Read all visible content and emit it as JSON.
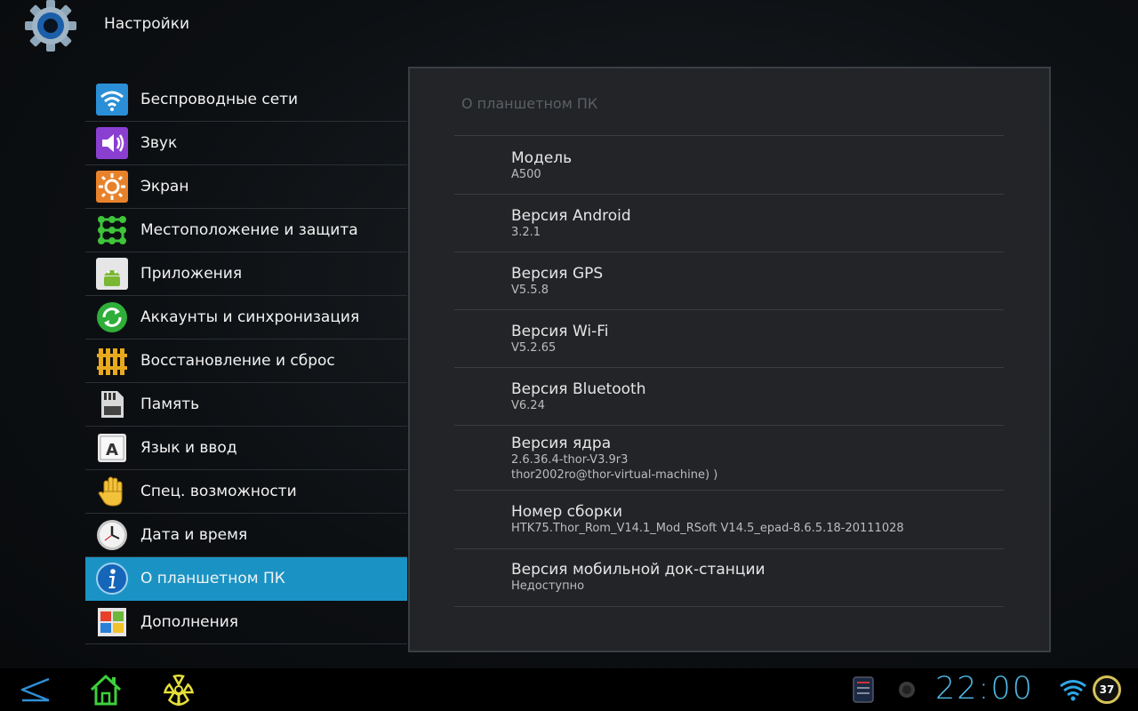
{
  "app": {
    "title": "Настройки",
    "icon": "gear-icon"
  },
  "sidebar": {
    "items": [
      {
        "label": "Беспроводные сети",
        "icon": "wifi-icon"
      },
      {
        "label": "Звук",
        "icon": "speaker-icon"
      },
      {
        "label": "Экран",
        "icon": "brightness-icon"
      },
      {
        "label": "Местоположение и защита",
        "icon": "pattern-lock-icon"
      },
      {
        "label": "Приложения",
        "icon": "android-icon"
      },
      {
        "label": "Аккаунты и синхронизация",
        "icon": "sync-icon"
      },
      {
        "label": "Восстановление и сброс",
        "icon": "fence-icon"
      },
      {
        "label": "Память",
        "icon": "sd-card-icon"
      },
      {
        "label": "Язык и ввод",
        "icon": "keyboard-key-icon"
      },
      {
        "label": "Спец. возможности",
        "icon": "hand-icon"
      },
      {
        "label": "Дата и время",
        "icon": "clock-icon"
      },
      {
        "label": "О планшетном ПК",
        "icon": "info-icon",
        "active": true
      },
      {
        "label": "Дополнения",
        "icon": "windows-icon"
      }
    ]
  },
  "panel": {
    "title": "О планшетном ПК",
    "rows": [
      {
        "title": "Модель",
        "value": "A500"
      },
      {
        "title": "Версия Android",
        "value": "3.2.1"
      },
      {
        "title": "Версия GPS",
        "value": "V5.5.8"
      },
      {
        "title": "Версия Wi-Fi",
        "value": "V5.2.65"
      },
      {
        "title": "Версия Bluetooth",
        "value": "V6.24"
      },
      {
        "title": "Версия ядра",
        "value": "2.6.36.4-thor-V3.9r3",
        "value2": "thor2002ro@thor-virtual-machine) )"
      },
      {
        "title": "Номер сборки",
        "value": "HTK75.Thor_Rom_V14.1_Mod_RSoft V14.5_epad-8.6.5.18-20111028"
      },
      {
        "title": "Версия мобильной док-станции",
        "value": "Недоступно"
      }
    ]
  },
  "navbar": {
    "clock": "22:00",
    "battery": "37",
    "colors": {
      "clock": "#4fb8e6",
      "back": "#2f8fd8",
      "home": "#3fcf3a",
      "radiation": "#e7e03a"
    }
  },
  "colors": {
    "accent": "#1a93c4"
  }
}
